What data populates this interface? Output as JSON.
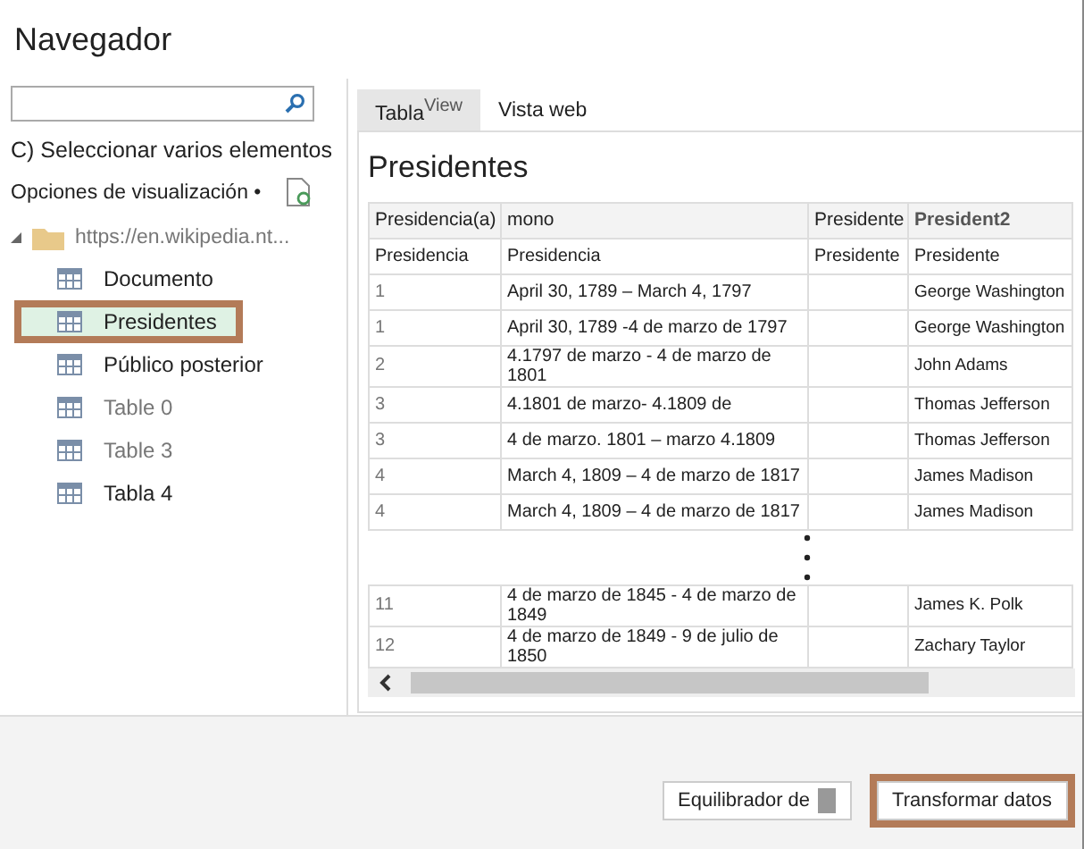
{
  "window": {
    "title": "Navegador"
  },
  "select_multiple": "C) Seleccionar varios elementos",
  "display_options": "Opciones de visualización •",
  "tree": [
    {
      "label": "https://en.wikipedia.nt...",
      "expanded": true,
      "children": [
        {
          "label": "Documento",
          "selected": false,
          "highlighted": false,
          "dimmed": false
        },
        {
          "label": "Presidentes",
          "selected": true,
          "highlighted": true,
          "dimmed": false
        },
        {
          "label": "Público posterior",
          "selected": false,
          "highlighted": false,
          "dimmed": false
        },
        {
          "label": "Table 0",
          "selected": false,
          "highlighted": false,
          "dimmed": true
        },
        {
          "label": "Table 3",
          "selected": false,
          "highlighted": false,
          "dimmed": true
        },
        {
          "label": "Tabla 4",
          "selected": false,
          "highlighted": false,
          "dimmed": false
        }
      ]
    }
  ],
  "tabs": [
    {
      "label": "Tabla$^{View}$",
      "selected": true
    },
    {
      "label": "Vista web",
      "selected": false
    }
  ],
  "preview": {
    "title": "Presidentes",
    "table": {
      "columns": [
        "Presidencia(a)",
        "mono",
        "Presidente",
        "President2"
      ],
      "subheader": [
        "Presidencia",
        "Presidencia",
        "Presidente",
        "Presidente"
      ],
      "rows": [
        {
          "number": "1",
          "dates": "April 30, 1789 – March 4, 1797",
          "president": "George Washington"
        },
        {
          "number": "1",
          "dates": "April 30, 1789 -4 de marzo de 1797",
          "president": "George Washington"
        },
        {
          "number": "2",
          "dates": "4.1797 de marzo - 4 de marzo de 1801",
          "president": "John Adams"
        },
        {
          "number": "3",
          "dates": "4.1801 de marzo- 4.1809 de",
          "president": "Thomas Jefferson"
        },
        {
          "number": "3",
          "dates": "4 de marzo. 1801 – marzo 4.1809",
          "president": "Thomas Jefferson"
        },
        {
          "number": "4",
          "dates": "March 4, 1809 – 4 de marzo de 1817",
          "president": "James Madison"
        },
        {
          "number": "4",
          "dates": "March 4, 1809 – 4 de marzo de 1817",
          "president": "James Madison"
        }
      ],
      "rows_after_gap": [
        {
          "number": "11",
          "dates": "4 de marzo de 1845 - 4 de marzo de 1849",
          "president": "James K. Polk"
        },
        {
          "number": "12",
          "dates": "4 de marzo de 1849 - 9 de julio de 1850",
          "president": "Zachary Taylor"
        }
      ]
    }
  },
  "buttons": [
    {
      "label": "Equilibrador de",
      "kind": "split",
      "highlighted": false
    },
    {
      "label": "Transformar datos",
      "kind": "plain",
      "highlighted": true
    }
  ]
}
